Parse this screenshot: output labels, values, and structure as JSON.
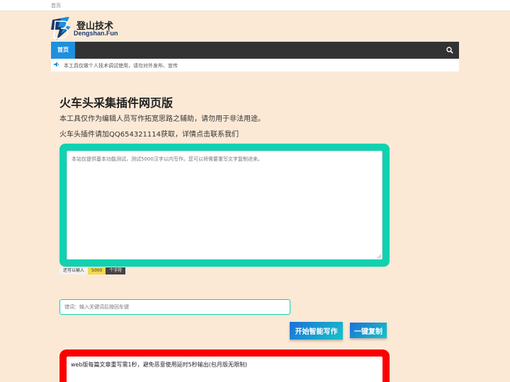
{
  "topbar": {
    "home_link": "首页"
  },
  "logo": {
    "title": "登山技术",
    "subtitle": "Dengshan.Fun"
  },
  "nav": {
    "home": "首页",
    "search_icon": "search-icon"
  },
  "notice": {
    "text": "本工具仅做个人技术调试使用，请勿对外发布、宣传",
    "icon": "speaker-icon"
  },
  "main": {
    "title": "火车头采集插件网页版",
    "desc1": "本工具仅作为编辑人员写作拓宽思路之辅助，请勿用于非法用途。",
    "desc2": "火车头插件请加QQ654321114获取，详情点击联系我们"
  },
  "editor": {
    "placeholder": "本站仅提供基本功能测试，测试5000汉字以内写作。您可以将需要重写文字复制进来。"
  },
  "counter": {
    "prefix": "还可以输入",
    "remaining": "5000",
    "suffix": "个字符"
  },
  "keyword": {
    "placeholder": "错词：输入关键词后按回车键"
  },
  "buttons": {
    "start": "开始智能写作",
    "copy": "一键复制"
  },
  "output": {
    "text": "web版每篇文章重写需1秒，避免恶意使用延时5秒输出(包月版无限制)"
  },
  "colors": {
    "accent": "#10d2b0",
    "output_border": "#fa0000",
    "nav_bg": "#333333",
    "nav_active": "#1e90e0"
  }
}
